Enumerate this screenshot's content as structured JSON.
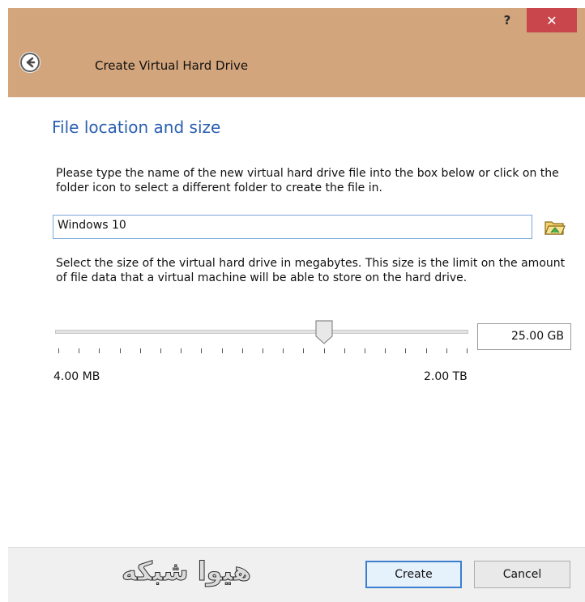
{
  "window": {
    "help_label": "?",
    "close_label": "✕",
    "title": "Create Virtual Hard Drive"
  },
  "page": {
    "heading": "File location and size",
    "location_text": "Please type the name of the new virtual hard drive file into the box below or click on the folder icon to select a different folder to create the file in.",
    "file_name_value": "Windows 10",
    "size_text": "Select the size of the virtual hard drive in megabytes. This size is the limit on the amount of file data that a virtual machine will be able to store on the hard drive.",
    "size_value": "25.00 GB",
    "slider_min_label": "4.00 MB",
    "slider_max_label": "2.00 TB",
    "slider_fraction": 0.65
  },
  "footer": {
    "watermark_text": "هیوا شبکه",
    "create_label": "Create",
    "cancel_label": "Cancel"
  },
  "icons": {
    "back": "back-arrow-icon",
    "folder": "folder-icon",
    "close": "close-icon"
  },
  "colors": {
    "titlebar": "#d3a57c",
    "close": "#c9464d",
    "heading": "#2a5fb0",
    "input_border": "#7aa7d8"
  }
}
